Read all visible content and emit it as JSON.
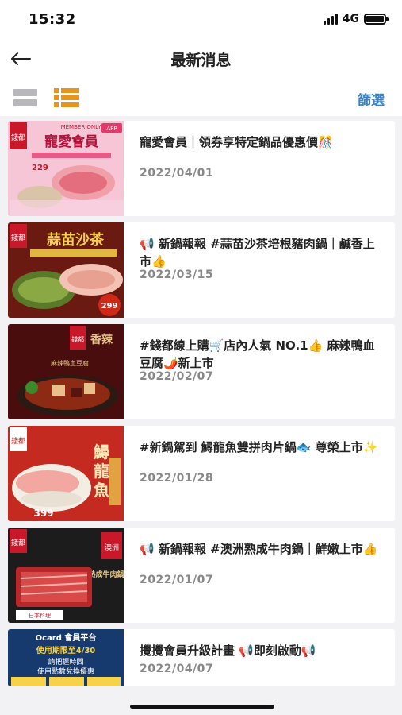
{
  "status": {
    "time": "15:32",
    "network": "4G"
  },
  "header": {
    "title": "最新消息",
    "back_icon": "arrow-left-icon"
  },
  "toolbar": {
    "filter_label": "篩選",
    "grid_icon": "grid-view-icon",
    "list_icon": "list-view-icon",
    "active_color": "#e8941c"
  },
  "news": [
    {
      "title": "寵愛會員｜領券享特定鍋品優惠價🎊",
      "date": "2022/04/01",
      "thumb_text": "寵愛會員",
      "thumb_badge": "MEMBER ONLY",
      "thumb_price": "229",
      "thumb_bg": "#f6c6d6"
    },
    {
      "title": "📢 新鍋報報 #蒜苗沙茶培根豬肉鍋｜鹹香上市👍",
      "date": "2022/03/15",
      "thumb_text": "蒜苗沙茶",
      "thumb_badge": "",
      "thumb_price": "299",
      "thumb_bg": "#6b1a12"
    },
    {
      "title": "#錢都線上購🛒店內人氣 NO.1👍 麻辣鴨血豆腐🌶️新上市",
      "date": "2022/02/07",
      "thumb_text": "麻辣鴨血豆腐",
      "thumb_badge": "",
      "thumb_price": "",
      "thumb_bg": "#4a0d0d"
    },
    {
      "title": "#新鍋駕到 鱘龍魚雙拼肉片鍋🐟 尊榮上市✨",
      "date": "2022/01/28",
      "thumb_text": "鱘龍魚",
      "thumb_badge": "",
      "thumb_price": "399",
      "thumb_bg": "#c42a20"
    },
    {
      "title": "📢 新鍋報報 #澳洲熟成牛肉鍋｜鮮嫩上市👍",
      "date": "2022/01/07",
      "thumb_text": "熟成牛肉鍋",
      "thumb_badge": "",
      "thumb_price": "",
      "thumb_bg": "#1c1c1c"
    },
    {
      "title": "攪攪會員升級計畫 📢即刻啟動📢",
      "date": "2022/04/07",
      "thumb_text": "Ocard 會員平台",
      "thumb_badge": "使用期限至4/30",
      "thumb_price": "",
      "thumb_bg": "#163a6e"
    }
  ]
}
